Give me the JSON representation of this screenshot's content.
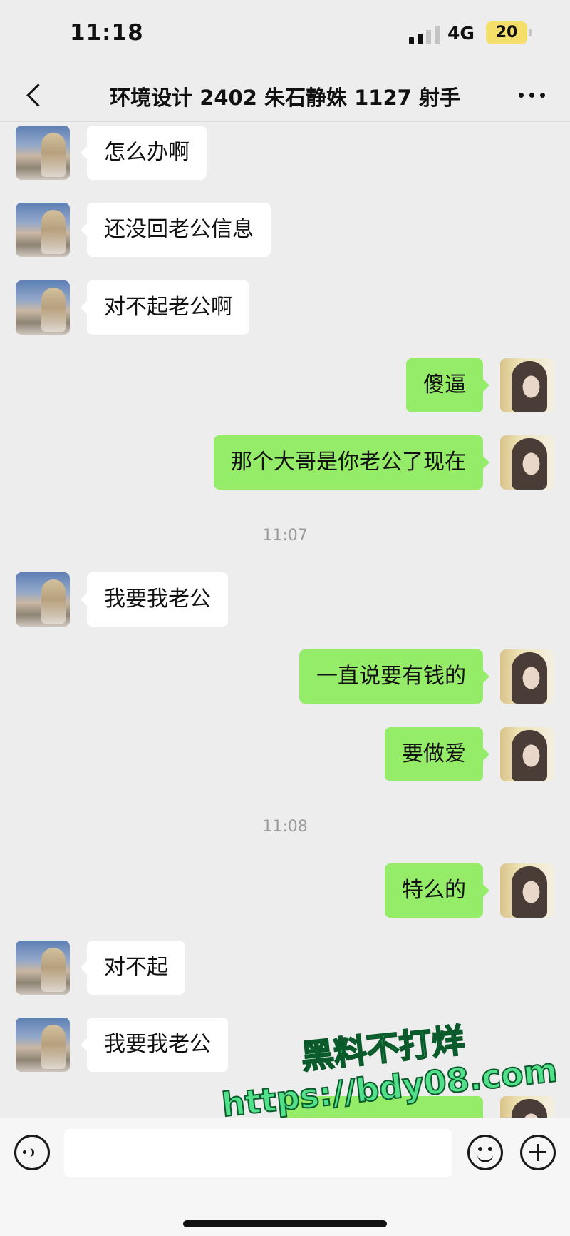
{
  "status_bar": {
    "time": "11:18",
    "network": "4G",
    "battery": "20"
  },
  "header": {
    "title": "环境设计 2402 朱石静姝 1127 射手",
    "back_icon": "chevron-left-icon",
    "more_icon": "more-horizontal-icon"
  },
  "messages": [
    {
      "side": "left",
      "text": "怎么办啊"
    },
    {
      "side": "left",
      "text": "还没回老公信息"
    },
    {
      "side": "left",
      "text": "对不起老公啊"
    },
    {
      "side": "right",
      "text": "傻逼"
    },
    {
      "side": "right",
      "text": "那个大哥是你老公了现在"
    },
    {
      "timestamp": "11:07"
    },
    {
      "side": "left",
      "text": "我要我老公"
    },
    {
      "side": "right",
      "text": "一直说要有钱的"
    },
    {
      "side": "right",
      "text": "要做爱"
    },
    {
      "timestamp": "11:08"
    },
    {
      "side": "right",
      "text": "特么的"
    },
    {
      "side": "left",
      "text": "对不起"
    },
    {
      "side": "left",
      "text": "我要我老公"
    }
  ],
  "watermark": {
    "line1": "黑料不打烊",
    "line2": "https://bdy08.com"
  },
  "input_bar": {
    "voice_icon": "voice-icon",
    "emoji_icon": "emoji-icon",
    "plus_icon": "plus-icon"
  },
  "colors": {
    "background": "#ededed",
    "incoming_bubble": "#ffffff",
    "outgoing_bubble": "#95ec69",
    "battery": "#f3df6a",
    "watermark": "#52e08a"
  }
}
